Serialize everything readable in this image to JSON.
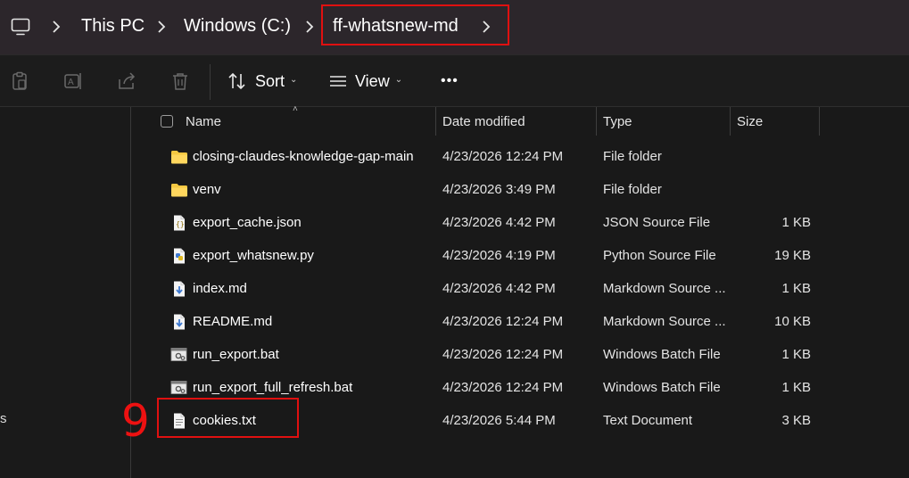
{
  "breadcrumb": {
    "items": [
      "This PC",
      "Windows (C:)",
      "ff-whatsnew-md"
    ]
  },
  "toolbar": {
    "sort_label": "Sort",
    "view_label": "View",
    "more_label": "•••"
  },
  "navpane": {
    "partial_text": "s"
  },
  "columns": {
    "name": "Name",
    "date": "Date modified",
    "type": "Type",
    "size": "Size"
  },
  "files": [
    {
      "name": "closing-claudes-knowledge-gap-main",
      "date": "4/23/2026 12:24 PM",
      "type": "File folder",
      "size": "",
      "icon": "folder-icon"
    },
    {
      "name": "venv",
      "date": "4/23/2026 3:49 PM",
      "type": "File folder",
      "size": "",
      "icon": "folder-icon"
    },
    {
      "name": "export_cache.json",
      "date": "4/23/2026 4:42 PM",
      "type": "JSON Source File",
      "size": "1 KB",
      "icon": "json-file-icon"
    },
    {
      "name": "export_whatsnew.py",
      "date": "4/23/2026 4:19 PM",
      "type": "Python Source File",
      "size": "19 KB",
      "icon": "python-file-icon"
    },
    {
      "name": "index.md",
      "date": "4/23/2026 4:42 PM",
      "type": "Markdown Source ...",
      "size": "1 KB",
      "icon": "markdown-file-icon"
    },
    {
      "name": "README.md",
      "date": "4/23/2026 12:24 PM",
      "type": "Markdown Source ...",
      "size": "10 KB",
      "icon": "markdown-file-icon"
    },
    {
      "name": "run_export.bat",
      "date": "4/23/2026 12:24 PM",
      "type": "Windows Batch File",
      "size": "1 KB",
      "icon": "batch-file-icon"
    },
    {
      "name": "run_export_full_refresh.bat",
      "date": "4/23/2026 12:24 PM",
      "type": "Windows Batch File",
      "size": "1 KB",
      "icon": "batch-file-icon"
    },
    {
      "name": "cookies.txt",
      "date": "4/23/2026 5:44 PM",
      "type": "Text Document",
      "size": "3 KB",
      "icon": "text-file-icon"
    }
  ],
  "annotation": {
    "step_number": "9"
  },
  "colors": {
    "highlight": "#e01010",
    "folder": "#f5c842",
    "background": "#191919"
  }
}
